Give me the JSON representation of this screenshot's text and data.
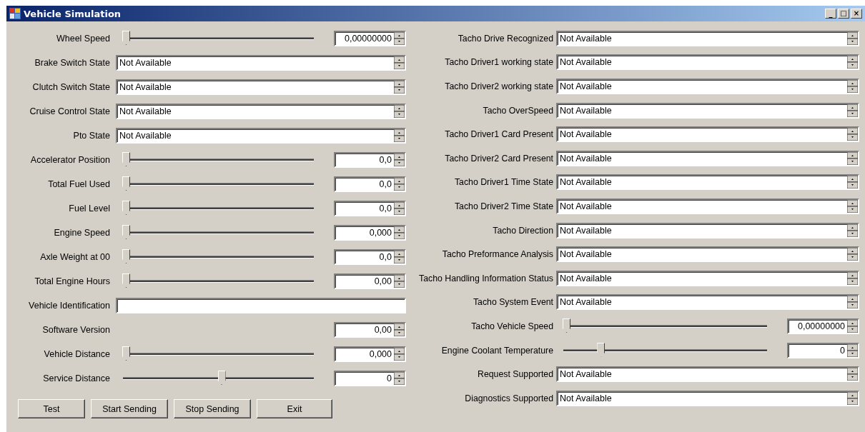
{
  "window": {
    "title": "Vehicle Simulation",
    "controls": [
      "_",
      "□",
      "×"
    ]
  },
  "left_rows": [
    {
      "label": "Wheel Speed",
      "kind": "slider",
      "level": 0,
      "value": "0,00000000"
    },
    {
      "label": "Brake Switch State",
      "kind": "select",
      "value": "Not Available"
    },
    {
      "label": "Clutch Switch State",
      "kind": "select",
      "value": "Not Available"
    },
    {
      "label": "Cruise Control State",
      "kind": "select",
      "value": "Not Available"
    },
    {
      "label": "Pto State",
      "kind": "select",
      "value": "Not Available"
    },
    {
      "label": "Accelerator Position",
      "kind": "slider",
      "level": 0,
      "value": "0,0"
    },
    {
      "label": "Total Fuel Used",
      "kind": "slider",
      "level": 0,
      "value": "0,0"
    },
    {
      "label": "Fuel Level",
      "kind": "slider",
      "level": 0,
      "value": "0,0"
    },
    {
      "label": "Engine Speed",
      "kind": "slider",
      "level": 0,
      "value": "0,000"
    },
    {
      "label": "Axle Weight at 00",
      "kind": "slider",
      "level": 0,
      "value": "0,0"
    },
    {
      "label": "Total Engine Hours",
      "kind": "slider",
      "level": 0,
      "value": "0,00"
    },
    {
      "label": "Vehicle Identification",
      "kind": "text"
    },
    {
      "label": "Software Version",
      "kind": "number",
      "value": "0,00"
    },
    {
      "label": "Vehicle Distance",
      "kind": "slider",
      "level": 0,
      "value": "0,000"
    },
    {
      "label": "Service Distance",
      "kind": "slider",
      "level": 0.5,
      "value": "0"
    }
  ],
  "buttons": [
    "Test",
    "Start Sending",
    "Stop Sending",
    "Exit"
  ],
  "right_rows": [
    {
      "label": "Tacho Drive Recognized",
      "kind": "select",
      "value": "Not Available"
    },
    {
      "label": "Tacho Driver1 working state",
      "kind": "select",
      "value": "Not Available"
    },
    {
      "label": "Tacho Driver2 working state",
      "kind": "select",
      "value": "Not Available"
    },
    {
      "label": "Tacho OverSpeed",
      "kind": "select",
      "value": "Not Available"
    },
    {
      "label": "Tacho Driver1 Card Present",
      "kind": "select",
      "value": "Not Available"
    },
    {
      "label": "Tacho Driver2 Card Present",
      "kind": "select",
      "value": "Not Available"
    },
    {
      "label": "Tacho Driver1 Time State",
      "kind": "select",
      "value": "Not Available"
    },
    {
      "label": "Tacho Driver2 Time State",
      "kind": "select",
      "value": "Not Available"
    },
    {
      "label": "Tacho Direction",
      "kind": "select",
      "value": "Not Available"
    },
    {
      "label": "Tacho Preformance Analysis",
      "kind": "select",
      "value": "Not Available"
    },
    {
      "label": "Tacho Handling Information Status",
      "kind": "select",
      "value": "Not Available"
    },
    {
      "label": "Tacho System Event",
      "kind": "select",
      "value": "Not Available"
    },
    {
      "label": "Tacho Vehicle Speed",
      "kind": "slider",
      "level": 0,
      "value": "0,00000000"
    },
    {
      "label": "Engine Coolant Temperature",
      "kind": "slider",
      "level": 0.17,
      "value": "0"
    },
    {
      "label": "Request Supported",
      "kind": "select",
      "value": "Not Available"
    },
    {
      "label": "Diagnostics Supported",
      "kind": "select",
      "value": "Not Available"
    }
  ]
}
